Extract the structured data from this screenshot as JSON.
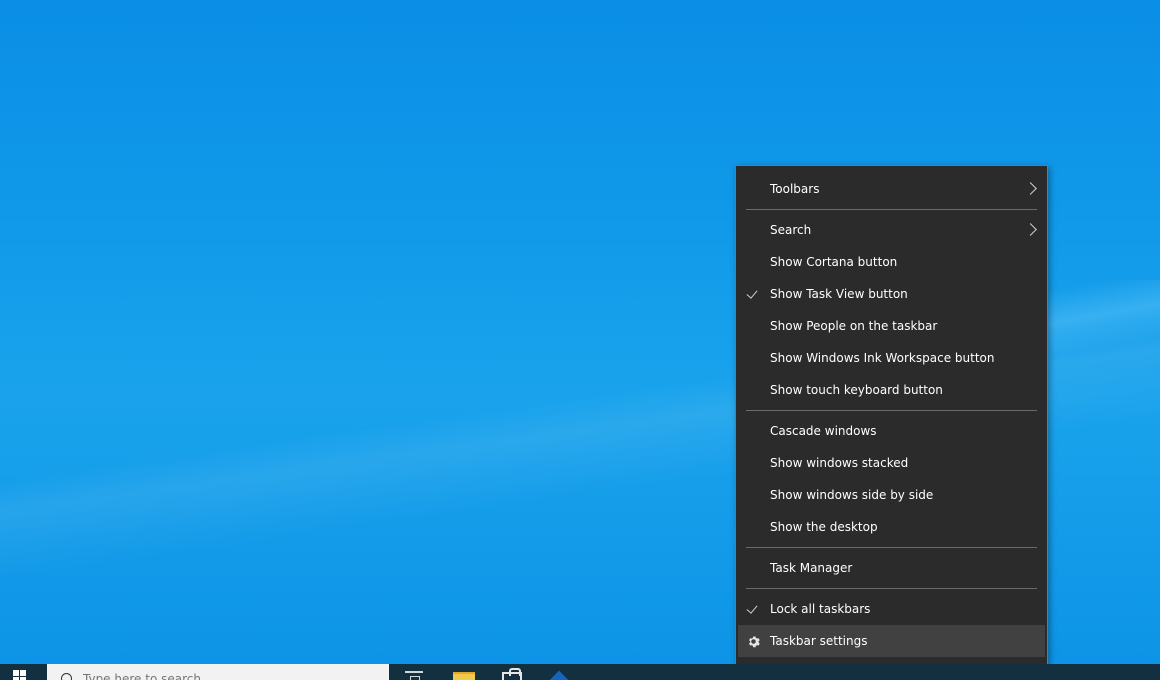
{
  "colors": {
    "desktop_background": "#0a8fe6",
    "menu_background": "#2b2b2b",
    "menu_highlight": "#414141",
    "menu_border": "#767676",
    "menu_text": "#ffffff",
    "taskbar": "#12303f"
  },
  "context_menu": {
    "items": [
      {
        "label": "Toolbars",
        "submenu": true,
        "checked": false
      },
      {
        "label": "Search",
        "submenu": true,
        "checked": false
      },
      {
        "label": "Show Cortana button",
        "submenu": false,
        "checked": false
      },
      {
        "label": "Show Task View button",
        "submenu": false,
        "checked": true
      },
      {
        "label": "Show People on the taskbar",
        "submenu": false,
        "checked": false
      },
      {
        "label": "Show Windows Ink Workspace button",
        "submenu": false,
        "checked": false
      },
      {
        "label": "Show touch keyboard button",
        "submenu": false,
        "checked": false
      },
      {
        "label": "Cascade windows",
        "submenu": false,
        "checked": false
      },
      {
        "label": "Show windows stacked",
        "submenu": false,
        "checked": false
      },
      {
        "label": "Show windows side by side",
        "submenu": false,
        "checked": false
      },
      {
        "label": "Show the desktop",
        "submenu": false,
        "checked": false
      },
      {
        "label": "Task Manager",
        "submenu": false,
        "checked": false
      },
      {
        "label": "Lock all taskbars",
        "submenu": false,
        "checked": true
      },
      {
        "label": "Taskbar settings",
        "submenu": false,
        "checked": false,
        "icon": "gear-icon",
        "highlighted": true
      }
    ]
  },
  "taskbar": {
    "search_placeholder": "Type here to search",
    "icons": [
      "windows-start-icon",
      "search-icon",
      "task-view-icon",
      "file-explorer-icon",
      "store-icon",
      "app-icon"
    ]
  }
}
